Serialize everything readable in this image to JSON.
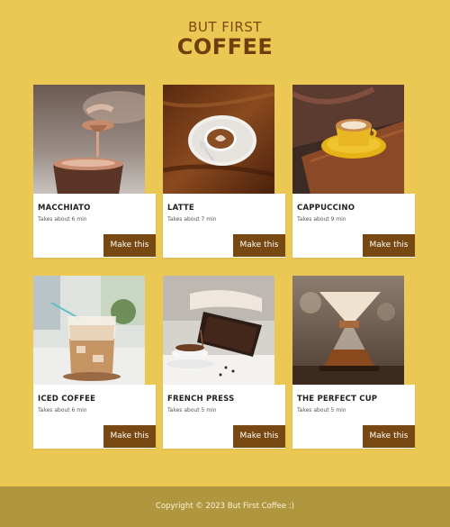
{
  "header": {
    "pre_title": "BUT FIRST",
    "title": "COFFEE"
  },
  "cards": [
    {
      "name": "MACCHIATO",
      "time": "Takes about 6 min",
      "button": "Make this",
      "icon": "macchiato-photo"
    },
    {
      "name": "LATTE",
      "time": "Takes about 7 min",
      "button": "Make this",
      "icon": "latte-photo"
    },
    {
      "name": "CAPPUCCINO",
      "time": "Takes about 9 min",
      "button": "Make this",
      "icon": "cappuccino-photo"
    },
    {
      "name": "ICED COFFEE",
      "time": "Takes about 6 min",
      "button": "Make this",
      "icon": "iced-coffee-photo"
    },
    {
      "name": "FRENCH PRESS",
      "time": "Takes about 5 min",
      "button": "Make this",
      "icon": "french-press-photo"
    },
    {
      "name": "THE PERFECT CUP",
      "time": "Takes about 5 min",
      "button": "Make this",
      "icon": "chemex-photo"
    }
  ],
  "footer": {
    "copyright": "Copyright © 2023 But First Coffee :)"
  },
  "colors": {
    "background": "#ebc854",
    "accent": "#774812",
    "footer": "#b0973f"
  }
}
